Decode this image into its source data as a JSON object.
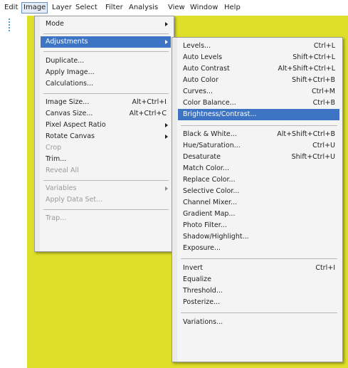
{
  "menubar": {
    "items": [
      "Edit",
      "Image",
      "Layer",
      "Select",
      "Filter",
      "Analysis",
      "View",
      "Window",
      "Help"
    ]
  },
  "image_menu": {
    "items": [
      {
        "label": "Mode",
        "shortcut": ""
      },
      {
        "label": "Adjustments",
        "shortcut": ""
      },
      {
        "label": "Duplicate...",
        "shortcut": ""
      },
      {
        "label": "Apply Image...",
        "shortcut": ""
      },
      {
        "label": "Calculations...",
        "shortcut": ""
      },
      {
        "label": "Image Size...",
        "shortcut": "Alt+Ctrl+I"
      },
      {
        "label": "Canvas Size...",
        "shortcut": "Alt+Ctrl+C"
      },
      {
        "label": "Pixel Aspect Ratio",
        "shortcut": ""
      },
      {
        "label": "Rotate Canvas",
        "shortcut": ""
      },
      {
        "label": "Crop",
        "shortcut": ""
      },
      {
        "label": "Trim...",
        "shortcut": ""
      },
      {
        "label": "Reveal All",
        "shortcut": ""
      },
      {
        "label": "Variables",
        "shortcut": ""
      },
      {
        "label": "Apply Data Set...",
        "shortcut": ""
      },
      {
        "label": "Trap...",
        "shortcut": ""
      }
    ]
  },
  "adjustments_menu": {
    "items": [
      {
        "label": "Levels...",
        "shortcut": "Ctrl+L"
      },
      {
        "label": "Auto Levels",
        "shortcut": "Shift+Ctrl+L"
      },
      {
        "label": "Auto Contrast",
        "shortcut": "Alt+Shift+Ctrl+L"
      },
      {
        "label": "Auto Color",
        "shortcut": "Shift+Ctrl+B"
      },
      {
        "label": "Curves...",
        "shortcut": "Ctrl+M"
      },
      {
        "label": "Color Balance...",
        "shortcut": "Ctrl+B"
      },
      {
        "label": "Brightness/Contrast...",
        "shortcut": ""
      },
      {
        "label": "Black & White...",
        "shortcut": "Alt+Shift+Ctrl+B"
      },
      {
        "label": "Hue/Saturation...",
        "shortcut": "Ctrl+U"
      },
      {
        "label": "Desaturate",
        "shortcut": "Shift+Ctrl+U"
      },
      {
        "label": "Match Color...",
        "shortcut": ""
      },
      {
        "label": "Replace Color...",
        "shortcut": ""
      },
      {
        "label": "Selective Color...",
        "shortcut": ""
      },
      {
        "label": "Channel Mixer...",
        "shortcut": ""
      },
      {
        "label": "Gradient Map...",
        "shortcut": ""
      },
      {
        "label": "Photo Filter...",
        "shortcut": ""
      },
      {
        "label": "Shadow/Highlight...",
        "shortcut": ""
      },
      {
        "label": "Exposure...",
        "shortcut": ""
      },
      {
        "label": "Invert",
        "shortcut": "Ctrl+I"
      },
      {
        "label": "Equalize",
        "shortcut": ""
      },
      {
        "label": "Threshold...",
        "shortcut": ""
      },
      {
        "label": "Posterize...",
        "shortcut": ""
      },
      {
        "label": "Variations...",
        "shortcut": ""
      }
    ]
  },
  "colors": {
    "canvas": "#dddf28",
    "highlight": "#3d74c4",
    "menu_bg": "#f4f4f4",
    "disabled_text": "#9a9a9a"
  }
}
